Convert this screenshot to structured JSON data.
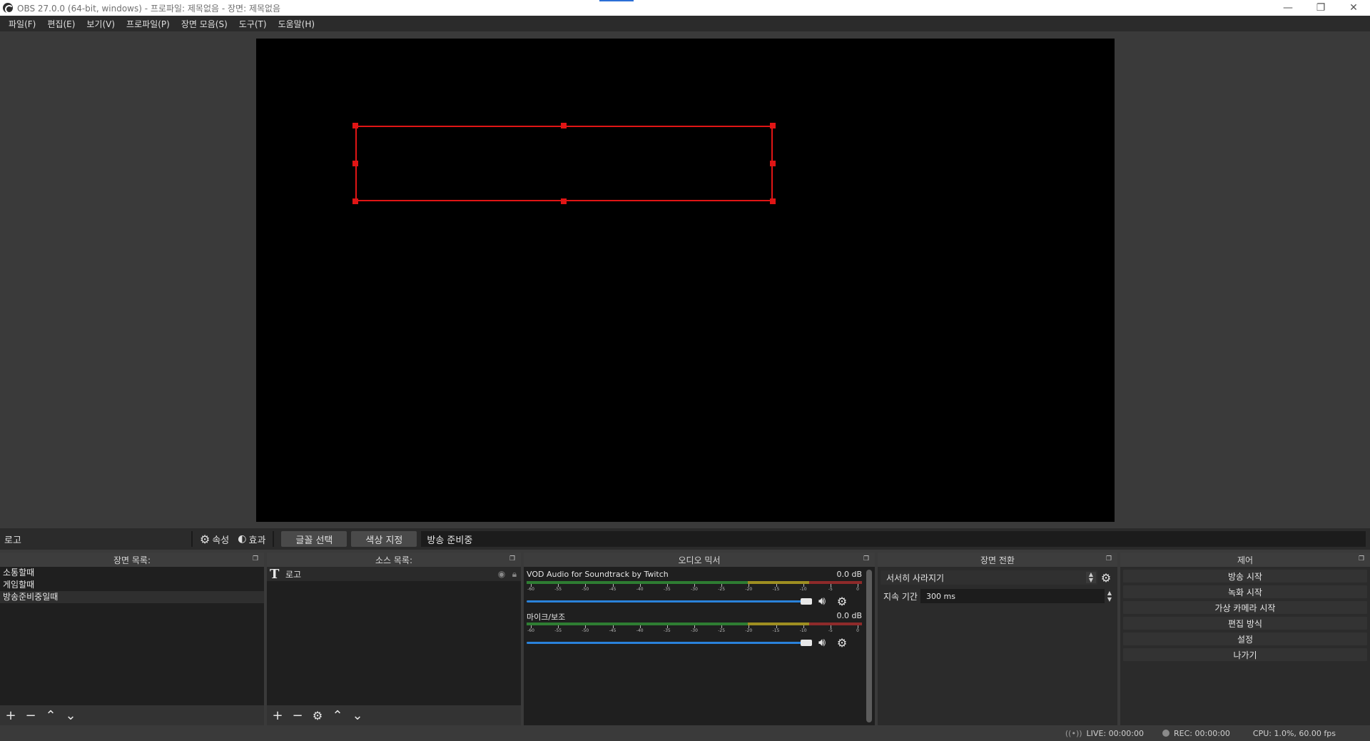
{
  "window": {
    "title": "OBS 27.0.0 (64-bit, windows) - 프로파일: 제목없음 - 장면: 제목없음",
    "minimize_glyph": "—",
    "restore_glyph": "❐",
    "close_glyph": "✕"
  },
  "menu": [
    {
      "label": "파일(F)"
    },
    {
      "label": "편집(E)"
    },
    {
      "label": "보기(V)"
    },
    {
      "label": "프로파일(P)"
    },
    {
      "label": "장면 모음(S)"
    },
    {
      "label": "도구(T)"
    },
    {
      "label": "도움말(H)"
    }
  ],
  "context_bar": {
    "source_name": "로고",
    "properties_label": "속성",
    "filters_label": "효과",
    "font_button": "글꼴 선택",
    "color_button": "색상 지정",
    "text_value": "방송 준비중"
  },
  "scenes": {
    "title": "장면 목록:",
    "items": [
      {
        "label": "소통할때",
        "selected": false
      },
      {
        "label": "게임할때",
        "selected": false
      },
      {
        "label": "방송준비중일때",
        "selected": true
      }
    ]
  },
  "sources": {
    "title": "소스 목록:",
    "items": [
      {
        "label": "로고",
        "type_icon": "T"
      }
    ]
  },
  "mixer": {
    "title": "오디오 믹서",
    "tick_labels": [
      "-60",
      "-55",
      "-50",
      "-45",
      "-40",
      "-35",
      "-30",
      "-25",
      "-20",
      "-15",
      "-10",
      "-5",
      "0"
    ],
    "channels": [
      {
        "name": "VOD Audio for Soundtrack by Twitch",
        "db": "0.0 dB",
        "volume": 1.0
      },
      {
        "name": "마이크/보조",
        "db": "0.0 dB",
        "volume": 1.0
      }
    ]
  },
  "transitions": {
    "title": "장면 전환",
    "selected": "서서히 사라지기",
    "duration_label": "지속 기간",
    "duration_value": "300 ms"
  },
  "controls": {
    "title": "제어",
    "buttons": [
      {
        "label": "방송 시작"
      },
      {
        "label": "녹화 시작"
      },
      {
        "label": "가상 카메라 시작"
      },
      {
        "label": "편집 방식"
      },
      {
        "label": "설정"
      },
      {
        "label": "나가기"
      }
    ]
  },
  "status": {
    "live": "LIVE: 00:00:00",
    "rec": "REC: 00:00:00",
    "cpu": "CPU: 1.0%, 60.00 fps"
  },
  "colors": {
    "selection": "#e01515",
    "volume_track": "#2a82da",
    "meter_green": "#2e7d32",
    "meter_yellow": "#9e8e21",
    "meter_red": "#8e2a2a"
  }
}
